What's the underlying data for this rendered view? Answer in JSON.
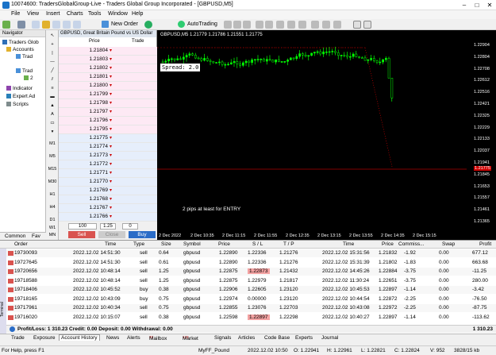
{
  "window": {
    "title": "10074600: TradersGlobalGroup-Live - Traders Global Group Incorporated - [GBPUSD,M5]"
  },
  "menu": [
    "File",
    "View",
    "Insert",
    "Charts",
    "Tools",
    "Window",
    "Help"
  ],
  "toolbar": {
    "new_order": "New Order",
    "autotrading": "AutoTrading"
  },
  "navigator": {
    "title": "Navigator",
    "items": [
      "Traders Glob",
      "Accounts",
      "Trad",
      "Trad",
      "2",
      "Indicator",
      "Expert Ad",
      "Scripts"
    ],
    "tabs": [
      "Common",
      "Fav"
    ]
  },
  "draw_tools": [
    "M1",
    "M5",
    "M15",
    "M30",
    "H1",
    "H4",
    "D1",
    "W1",
    "MN"
  ],
  "dom": {
    "title": "GBPUSD, Great Britain Pound vs US Dollar",
    "col_price": "Price",
    "col_trade": "Trade",
    "ask_prices": [
      "1.21804",
      "1.21803",
      "1.21802",
      "1.21801",
      "1.21800",
      "1.21799",
      "1.21798",
      "1.21797",
      "1.21796",
      "1.21795"
    ],
    "bid_prices": [
      "1.21775",
      "1.21774",
      "1.21773",
      "1.21772",
      "1.21771",
      "1.21770",
      "1.21769",
      "1.21768",
      "1.21767",
      "1.21766"
    ],
    "volume": "100",
    "lot": "1.25",
    "tp": "0",
    "sell": "Sell",
    "close": "Close",
    "buy": "Buy"
  },
  "chart": {
    "header": "GBPUSD,M5  1.21779 1.21786 1.21551 1.21775",
    "spread_label": "Spread: 2.0",
    "annotation": "2 pips at least for ENTRY",
    "price_ticks": [
      "1.22904",
      "1.22804",
      "1.22708",
      "1.22612",
      "1.22516",
      "1.22421",
      "1.22325",
      "1.22229",
      "1.22133",
      "1.22037",
      "1.21941",
      "1.21845",
      "1.21775",
      "1.21653",
      "1.21557",
      "1.21461",
      "1.21365"
    ],
    "current_price": "1.21775",
    "time_ticks": [
      "2 Dec 2022",
      "2 Dec 10:35",
      "2 Dec 11:15",
      "2 Dec 11:55",
      "2 Dec 12:35",
      "2 Dec 13:15",
      "2 Dec 13:55",
      "2 Dec 14:35",
      "2 Dec 15:15"
    ]
  },
  "terminal": {
    "headers": [
      "Order",
      "Time",
      "Type",
      "Size",
      "Symbol",
      "Price",
      "S / L",
      "T / P",
      "Time",
      "Price",
      "Commiss...",
      "Swap",
      "Profit"
    ],
    "rows": [
      [
        "19730093",
        "2022.12.02 14:51:30",
        "sell",
        "0.64",
        "gbpusd",
        "1.22890",
        "1.22336",
        "1.21276",
        "2022.12.02 15:31:56",
        "1.21832",
        "-1.92",
        "0.00",
        "677.12"
      ],
      [
        "19727645",
        "2022.12.02 14:51:30",
        "sell",
        "0.61",
        "gbpusd",
        "1.22890",
        "1.22336",
        "1.21276",
        "2022.12.02 15:31:39",
        "1.21802",
        "-1.83",
        "0.00",
        "663.68"
      ],
      [
        "19720656",
        "2022.12.02 10:48:14",
        "sell",
        "1.25",
        "gbpusd",
        "1.22875",
        "1.22873",
        "1.21432",
        "2022.12.02 14:45:26",
        "1.22884",
        "-3.75",
        "0.00",
        "-11.25"
      ],
      [
        "19718588",
        "2022.12.02 10:48:14",
        "sell",
        "1.25",
        "gbpusd",
        "1.22875",
        "1.22979",
        "1.21817",
        "2022.12.02 11:30:24",
        "1.22651",
        "-3.75",
        "0.00",
        "280.00"
      ],
      [
        "19718406",
        "2022.12.02 10:45:52",
        "buy",
        "0.38",
        "gbpusd",
        "1.22906",
        "1.22605",
        "1.23120",
        "2022.12.02 10:45:53",
        "1.22897",
        "-1.14",
        "0.00",
        "-3.42"
      ],
      [
        "19718165",
        "2022.12.02 10:43:09",
        "buy",
        "0.75",
        "gbpusd",
        "1.22974",
        "0.00000",
        "1.23120",
        "2022.12.02 10:44:54",
        "1.22872",
        "-2.25",
        "0.00",
        "-76.50"
      ],
      [
        "19717961",
        "2022.12.02 10:40:34",
        "sell",
        "0.75",
        "gbpusd",
        "1.22855",
        "1.23076",
        "1.22703",
        "2022.12.02 10:43:08",
        "1.22972",
        "-2.25",
        "0.00",
        "-87.75"
      ],
      [
        "19716020",
        "2022.12.02 10:15:07",
        "sell",
        "0.38",
        "gbpusd",
        "1.22598",
        "1.22897",
        "1.22298",
        "2022.12.02 10:40:27",
        "1.22897",
        "-1.14",
        "0.00",
        "-113.62"
      ]
    ],
    "sl_highlight_rows": [
      2,
      7
    ],
    "summary": "Profit/Loss: 1 310.23  Credit: 0.00  Deposit: 0.00  Withdrawal: 0.00",
    "summary_total": "1 310.23",
    "side_label": "Terminal",
    "tabs": [
      "Trade",
      "Exposure",
      "Account History",
      "News",
      "Alerts",
      "Mailbox",
      "Market",
      "Signals",
      "Articles",
      "Code Base",
      "Experts",
      "Journal"
    ],
    "tab_badges": {
      "Mailbox": "22",
      "Market": "123"
    },
    "active_tab": "Account History"
  },
  "status": {
    "help": "For Help, press F1",
    "profile": "MyFF_Pound",
    "datetime": "2022.12.02 10:50",
    "open": "O: 1.22941",
    "high": "H: 1.22961",
    "low": "L: 1.22821",
    "close": "C: 1.22824",
    "volume": "V: 952",
    "traffic": "3828/15 kb"
  },
  "colors": {
    "buy": "#2a6cc7",
    "sell": "#d9534f",
    "ask_bg": "#fde9f4",
    "bid_bg": "#e6eefb",
    "chart_bg": "#000000",
    "bull_candle": "#00ff00",
    "bear_candle": "#000000"
  }
}
